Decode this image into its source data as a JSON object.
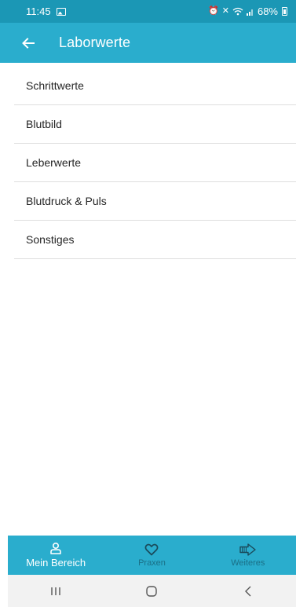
{
  "status_bar": {
    "time": "11:45",
    "battery": "68%",
    "icons": [
      "image-icon",
      "alarm-icon",
      "mute-icon",
      "wifi-icon",
      "signal-icon",
      "battery-icon"
    ]
  },
  "app_bar": {
    "title": "Laborwerte",
    "back_icon": "arrow-left-icon"
  },
  "list": {
    "items": [
      {
        "label": "Schrittwerte"
      },
      {
        "label": "Blutbild"
      },
      {
        "label": "Leberwerte"
      },
      {
        "label": "Blutdruck & Puls"
      },
      {
        "label": "Sonstiges"
      }
    ]
  },
  "bottom_nav": {
    "items": [
      {
        "label": "Mein Bereich",
        "icon": "person-icon",
        "active": true
      },
      {
        "label": "Praxen",
        "icon": "heart-icon",
        "active": false
      },
      {
        "label": "Weiteres",
        "icon": "arrow-right-icon",
        "active": false
      }
    ]
  },
  "system_nav": {
    "buttons": [
      "recent-apps-icon",
      "home-icon",
      "back-icon"
    ]
  },
  "colors": {
    "status_bar": "#1b97b5",
    "app_bar": "#2aadcd",
    "inactive_nav_label": "#1a6f86"
  }
}
